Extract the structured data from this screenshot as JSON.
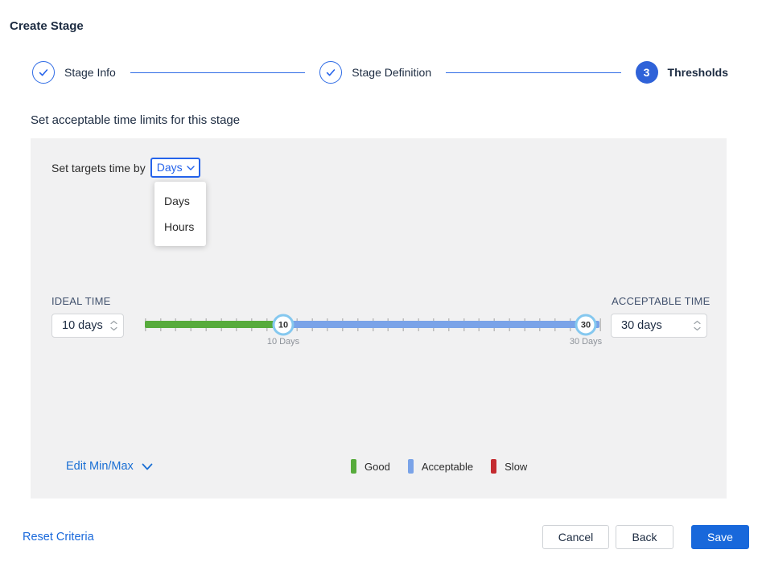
{
  "window": {
    "title": "Create Stage"
  },
  "stepper": {
    "steps": [
      {
        "label": "Stage Info",
        "state": "complete"
      },
      {
        "label": "Stage Definition",
        "state": "complete"
      },
      {
        "label": "Thresholds",
        "state": "current",
        "number": "3"
      }
    ]
  },
  "content": {
    "heading": "Set acceptable time limits for this stage",
    "targets_label": "Set targets time by",
    "unit_select": {
      "value": "Days",
      "options": [
        "Days",
        "Hours"
      ]
    }
  },
  "thresholds": {
    "ideal": {
      "label": "IDEAL TIME",
      "value": "10 days"
    },
    "acceptable": {
      "label": "ACCEPTABLE TIME",
      "value": "30 days"
    },
    "slider": {
      "handles": [
        {
          "value": "10",
          "tick_label": "10 Days"
        },
        {
          "value": "30",
          "tick_label": "30 Days"
        }
      ],
      "segments": [
        {
          "name": "good",
          "color": "#57ab3c"
        },
        {
          "name": "acceptable",
          "color": "#7aa3e8"
        }
      ]
    },
    "edit_minmax_label": "Edit Min/Max",
    "legend": [
      {
        "label": "Good",
        "color": "#57ab3c"
      },
      {
        "label": "Acceptable",
        "color": "#7aa3e8"
      },
      {
        "label": "Slow",
        "color": "#c42b30"
      }
    ]
  },
  "footer": {
    "reset_label": "Reset Criteria",
    "cancel_label": "Cancel",
    "back_label": "Back",
    "save_label": "Save"
  },
  "colors": {
    "primary_blue": "#2563eb",
    "step_badge_blue": "#2f62d8",
    "save_button_blue": "#1868db",
    "panel_background": "#f1f1f2",
    "handle_ring": "#85c8ef"
  }
}
